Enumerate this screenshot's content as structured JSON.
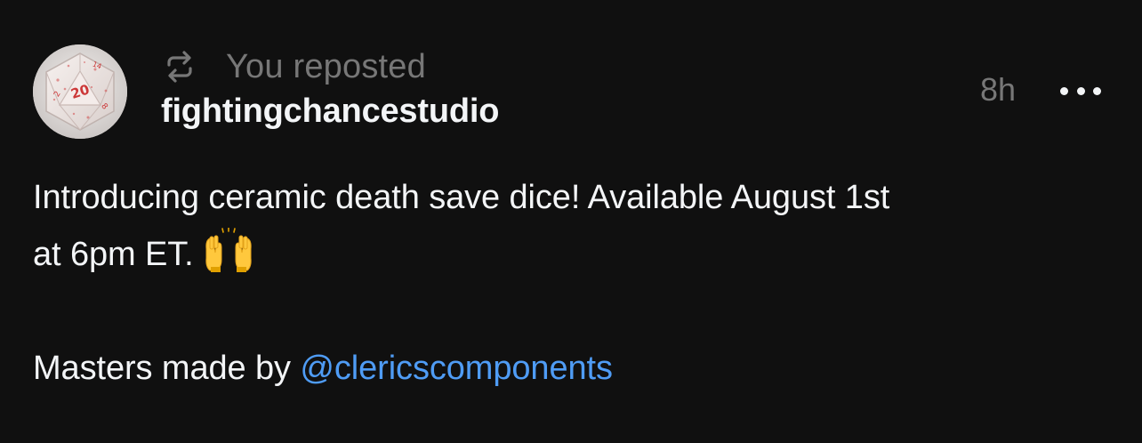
{
  "repost": {
    "label": "You reposted",
    "icon": "repost-icon"
  },
  "author": {
    "username": "fightingchancestudio",
    "avatar": "d20-dice-avatar"
  },
  "timestamp": "8h",
  "more": {
    "icon": "more-dots-icon"
  },
  "post": {
    "line1": "Introducing ceramic death save dice! Available August 1st",
    "line2": "at 6pm ET.",
    "emoji": "raising-hands-emoji",
    "line4_prefix": "Masters made by ",
    "mention": "@clericscomponents"
  },
  "colors": {
    "background": "#101010",
    "text": "#f3f5f7",
    "muted": "#777777",
    "link": "#4f9cf5"
  }
}
